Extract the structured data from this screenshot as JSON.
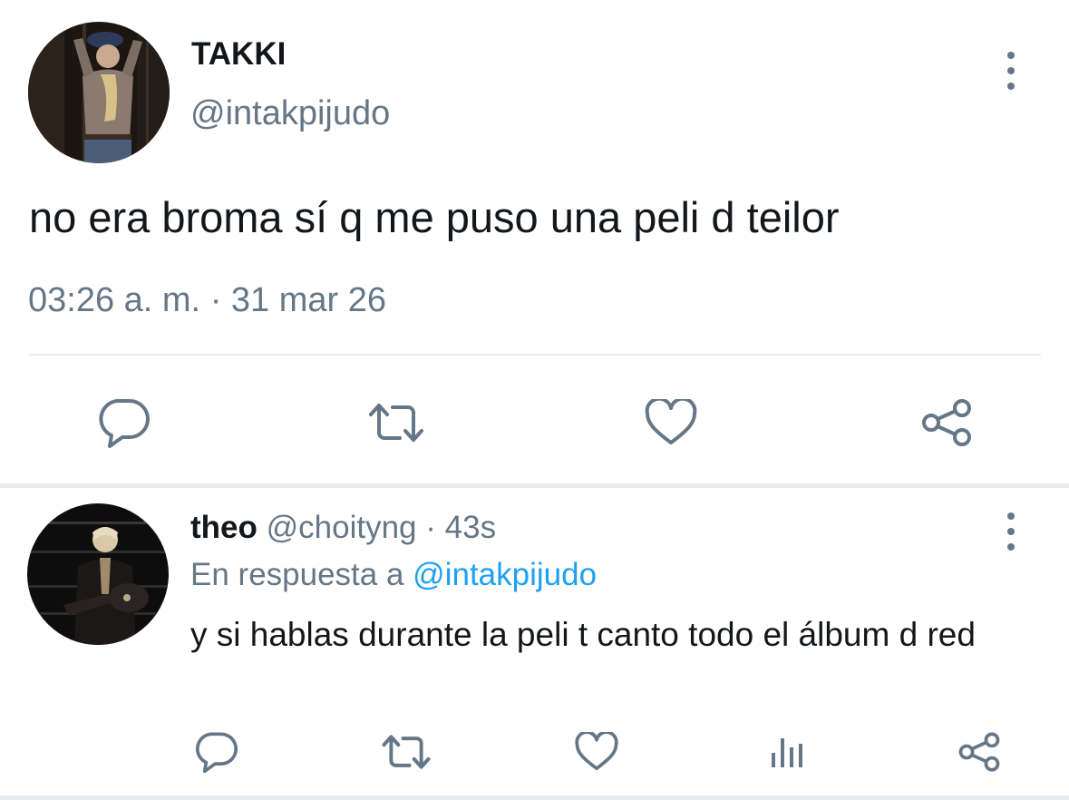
{
  "main_tweet": {
    "author_name": "TAKKI",
    "author_handle": "@intakpijudo",
    "text": "no era broma sí q me puso una peli d teilor",
    "time": "03:26 a. m.",
    "separator": "·",
    "date": "31 mar 26",
    "actions": [
      "reply-icon",
      "retweet-icon",
      "like-icon",
      "share-icon"
    ],
    "more_icon": "more-vertical-icon"
  },
  "reply": {
    "author_name": "theo",
    "author_handle": "@choityng",
    "separator": "·",
    "age": "43s",
    "in_reply_to_prefix": "En respuesta a",
    "in_reply_to_handle": "@intakpijudo",
    "text": "y si hablas durante la peli t canto todo el álbum d red",
    "actions": [
      "reply-icon",
      "retweet-icon",
      "like-icon",
      "analytics-icon",
      "share-icon"
    ],
    "more_icon": "more-vertical-icon"
  },
  "colors": {
    "text_primary": "#14171a",
    "text_secondary": "#657786",
    "link": "#1da1f2",
    "divider": "#e6ecf0"
  }
}
